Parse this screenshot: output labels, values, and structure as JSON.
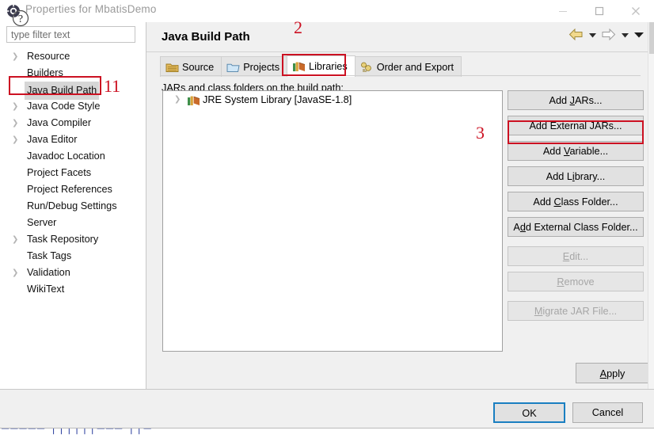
{
  "window": {
    "title": "Properties for MbatisDemo",
    "icon": "properties-gear-icon",
    "minimize_label": "Minimize",
    "maximize_label": "Maximize",
    "close_label": "Close"
  },
  "filter": {
    "placeholder": "type filter text",
    "value": ""
  },
  "tree": {
    "items": [
      {
        "label": "Resource",
        "expandable": true,
        "selected": false
      },
      {
        "label": "Builders",
        "expandable": false,
        "selected": false
      },
      {
        "label": "Java Build Path",
        "expandable": false,
        "selected": true
      },
      {
        "label": "Java Code Style",
        "expandable": true,
        "selected": false
      },
      {
        "label": "Java Compiler",
        "expandable": true,
        "selected": false
      },
      {
        "label": "Java Editor",
        "expandable": true,
        "selected": false
      },
      {
        "label": "Javadoc Location",
        "expandable": false,
        "selected": false
      },
      {
        "label": "Project Facets",
        "expandable": false,
        "selected": false
      },
      {
        "label": "Project References",
        "expandable": false,
        "selected": false
      },
      {
        "label": "Run/Debug Settings",
        "expandable": false,
        "selected": false
      },
      {
        "label": "Server",
        "expandable": false,
        "selected": false
      },
      {
        "label": "Task Repository",
        "expandable": true,
        "selected": false
      },
      {
        "label": "Task Tags",
        "expandable": false,
        "selected": false
      },
      {
        "label": "Validation",
        "expandable": true,
        "selected": false
      },
      {
        "label": "WikiText",
        "expandable": false,
        "selected": false
      }
    ]
  },
  "page": {
    "title": "Java Build Path",
    "hint": "JARs and class folders on the build path:"
  },
  "nav": {
    "back_icon": "back-arrow-icon",
    "back_menu_icon": "chevron-down-icon",
    "forward_icon": "forward-arrow-icon",
    "forward_menu_icon": "chevron-down-icon",
    "more_menu_icon": "chevron-down-icon"
  },
  "tabs": [
    {
      "label": "Source",
      "icon": "source-folder-icon",
      "active": false
    },
    {
      "label": "Projects",
      "icon": "projects-folder-icon",
      "active": false
    },
    {
      "label": "Libraries",
      "icon": "libraries-books-icon",
      "active": true
    },
    {
      "label": "Order and Export",
      "icon": "order-export-icon",
      "active": false
    }
  ],
  "library_list": [
    {
      "label": "JRE System Library [JavaSE-1.8]",
      "icon": "libraries-books-icon",
      "expandable": true
    }
  ],
  "buttons": [
    {
      "label": "Add JARs...",
      "mnemonic": "J",
      "enabled": true,
      "gap": false
    },
    {
      "label": "Add External JARs...",
      "mnemonic": "",
      "enabled": true,
      "gap": false
    },
    {
      "label": "Add Variable...",
      "mnemonic": "V",
      "enabled": true,
      "gap": false
    },
    {
      "label": "Add Library...",
      "mnemonic": "i",
      "enabled": true,
      "gap": false
    },
    {
      "label": "Add Class Folder...",
      "mnemonic": "C",
      "enabled": true,
      "gap": false
    },
    {
      "label": "Add External Class Folder...",
      "mnemonic": "d",
      "enabled": true,
      "gap": false
    },
    {
      "label": "Edit...",
      "mnemonic": "E",
      "enabled": false,
      "gap": true
    },
    {
      "label": "Remove",
      "mnemonic": "R",
      "enabled": false,
      "gap": false
    },
    {
      "label": "Migrate JAR File...",
      "mnemonic": "M",
      "enabled": false,
      "gap": true
    }
  ],
  "footer": {
    "apply_label": "Apply",
    "help_icon": "help-question-icon",
    "ok_label": "OK",
    "cancel_label": "Cancel"
  },
  "annotations": [
    {
      "id": 1,
      "text": "11"
    },
    {
      "id": 2,
      "text": "2"
    },
    {
      "id": 3,
      "text": "3"
    }
  ],
  "colors": {
    "annotation_red": "#cc1122",
    "focus_blue": "#1a7fc1",
    "panel_bg": "#f0f0f0",
    "selection_gray": "#d6d6d6"
  },
  "background_text": "partially visible blue text row"
}
